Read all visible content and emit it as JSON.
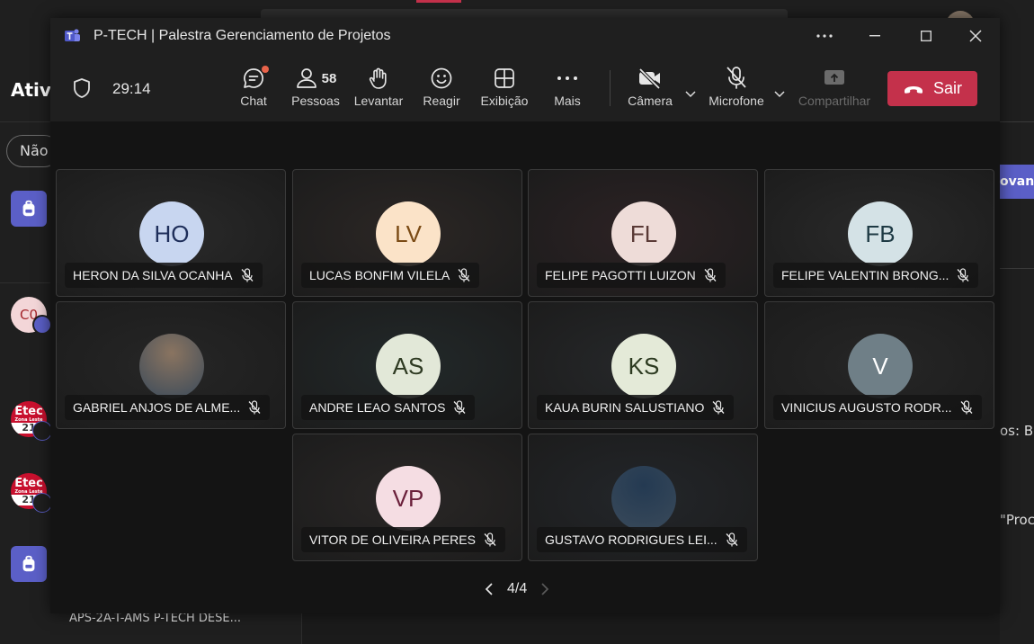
{
  "background": {
    "section_title": "Ativ",
    "filter_pill": "Não",
    "initials_avatar": "C0",
    "etec_top": "Etec",
    "etec_middle": "Zona Leste",
    "etec_bottom": "21",
    "channel_name": "APS-2A-T-AMS P-TECH DESE...",
    "right_button": "ovan",
    "right_text_1": "os: Bo",
    "right_text_2": "\"Proc"
  },
  "window": {
    "title": "P-TECH | Palestra Gerenciamento de Projetos"
  },
  "toolbar": {
    "timer": "29:14",
    "chat": "Chat",
    "people_count": "58",
    "people": "Pessoas",
    "raise": "Levantar",
    "react": "Reagir",
    "view": "Exibição",
    "more": "Mais",
    "camera": "Câmera",
    "mic": "Microfone",
    "share": "Compartilhar",
    "leave": "Sair"
  },
  "participants": [
    {
      "initials": "HO",
      "name": "HERON DA SILVA OCANHA",
      "avatar_bg": "#c8d6f0",
      "avatar_fg": "#1e2e5a",
      "tile_bg": "#2a2a2a"
    },
    {
      "initials": "LV",
      "name": "LUCAS BONFIM VILELA",
      "avatar_bg": "#fbe3c8",
      "avatar_fg": "#7a4a14",
      "tile_bg": "#2c2725"
    },
    {
      "initials": "FL",
      "name": "FELIPE PAGOTTI LUIZON",
      "avatar_bg": "#eedcd8",
      "avatar_fg": "#5a3a36",
      "tile_bg": "#2d2224"
    },
    {
      "initials": "FB",
      "name": "FELIPE VALENTIN BRONG...",
      "avatar_bg": "#d4e2e6",
      "avatar_fg": "#1e3a44",
      "tile_bg": "#2a2a2a"
    },
    {
      "initials": "",
      "name": "GABRIEL ANJOS DE ALME...",
      "avatar_bg": "#8a7460",
      "avatar_fg": "#ffffff",
      "tile_bg": "#262626"
    },
    {
      "initials": "AS",
      "name": "ANDRE LEAO SANTOS",
      "avatar_bg": "#e2e8d8",
      "avatar_fg": "#2e3a22",
      "tile_bg": "#22292a"
    },
    {
      "initials": "KS",
      "name": "KAUA BURIN SALUSTIANO",
      "avatar_bg": "#e4ead8",
      "avatar_fg": "#2c3a20",
      "tile_bg": "#26282a"
    },
    {
      "initials": "V",
      "name": "VINICIUS AUGUSTO RODR...",
      "avatar_bg": "#6f7f87",
      "avatar_fg": "#ffffff",
      "tile_bg": "#262626"
    },
    {
      "initials": "VP",
      "name": "VITOR DE OLIVEIRA PERES",
      "avatar_bg": "#f5dde3",
      "avatar_fg": "#6a1f3a",
      "tile_bg": "#2a2726"
    },
    {
      "initials": "",
      "name": "GUSTAVO RODRIGUES LEI...",
      "avatar_bg": "#243a52",
      "avatar_fg": "#ffffff",
      "tile_bg": "#23262a"
    }
  ],
  "pager": {
    "label": "4/4"
  }
}
